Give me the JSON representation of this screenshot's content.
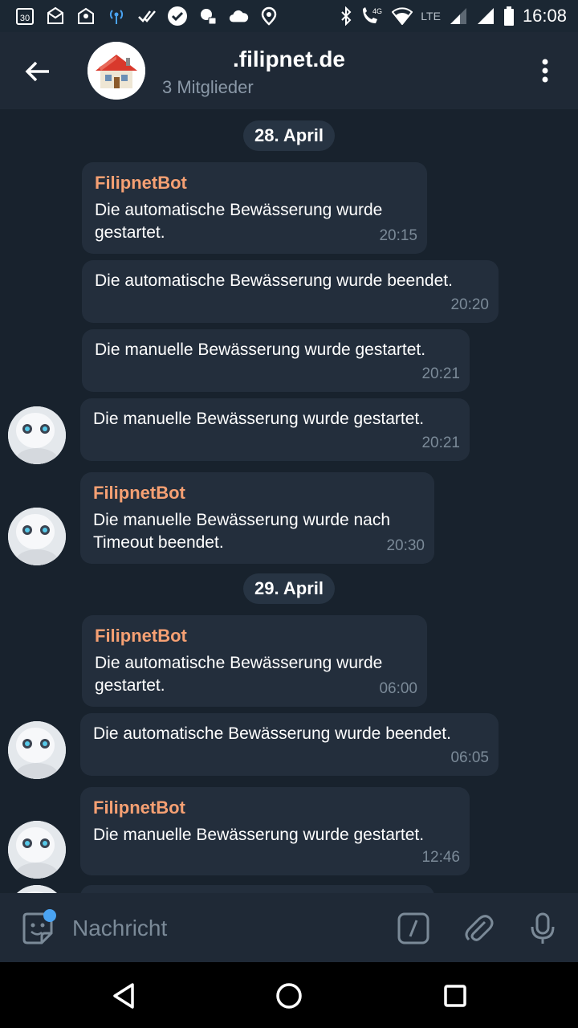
{
  "status_bar": {
    "time": "16:08",
    "network": "LTE",
    "net_badge": "4G",
    "left_badge": "30"
  },
  "header": {
    "title": ".filipnet.de",
    "subtitle": "3 Mitglieder"
  },
  "dates": [
    "28. April",
    "29. April"
  ],
  "messages": [
    {
      "sender": "FilipnetBot",
      "text": "Die automatische Bewässerung wurde gestartet.",
      "time": "20:15"
    },
    {
      "sender": "",
      "text": "Die automatische Bewässerung wurde beendet.",
      "time": "20:20"
    },
    {
      "sender": "",
      "text": "Die manuelle Bewässerung wurde gestartet.",
      "time": "20:21"
    },
    {
      "sender": "",
      "text": "Die manuelle Bewässerung wurde gestartet.",
      "time": "20:21"
    },
    {
      "sender": "FilipnetBot",
      "text": "Die manuelle Bewässerung wurde nach Timeout beendet.",
      "time": "20:30"
    },
    {
      "sender": "FilipnetBot",
      "text": "Die automatische Bewässerung wurde gestartet.",
      "time": "06:00"
    },
    {
      "sender": "",
      "text": "Die automatische Bewässerung wurde beendet.",
      "time": "06:05"
    },
    {
      "sender": "FilipnetBot",
      "text": "Die manuelle Bewässerung wurde gestartet.",
      "time": "12:46"
    }
  ],
  "input": {
    "placeholder": "Nachricht"
  },
  "colors": {
    "background": "#18222d",
    "bubble": "#232e3c",
    "sender_name": "#f5a073",
    "header": "#1f2936",
    "accent_dot": "#4aa3f2"
  },
  "icons": {
    "back": "arrow-left-icon",
    "menu": "more-vertical-icon",
    "emoji": "sticker-icon",
    "command": "slash-command-icon",
    "attach": "paperclip-icon",
    "mic": "microphone-icon"
  }
}
